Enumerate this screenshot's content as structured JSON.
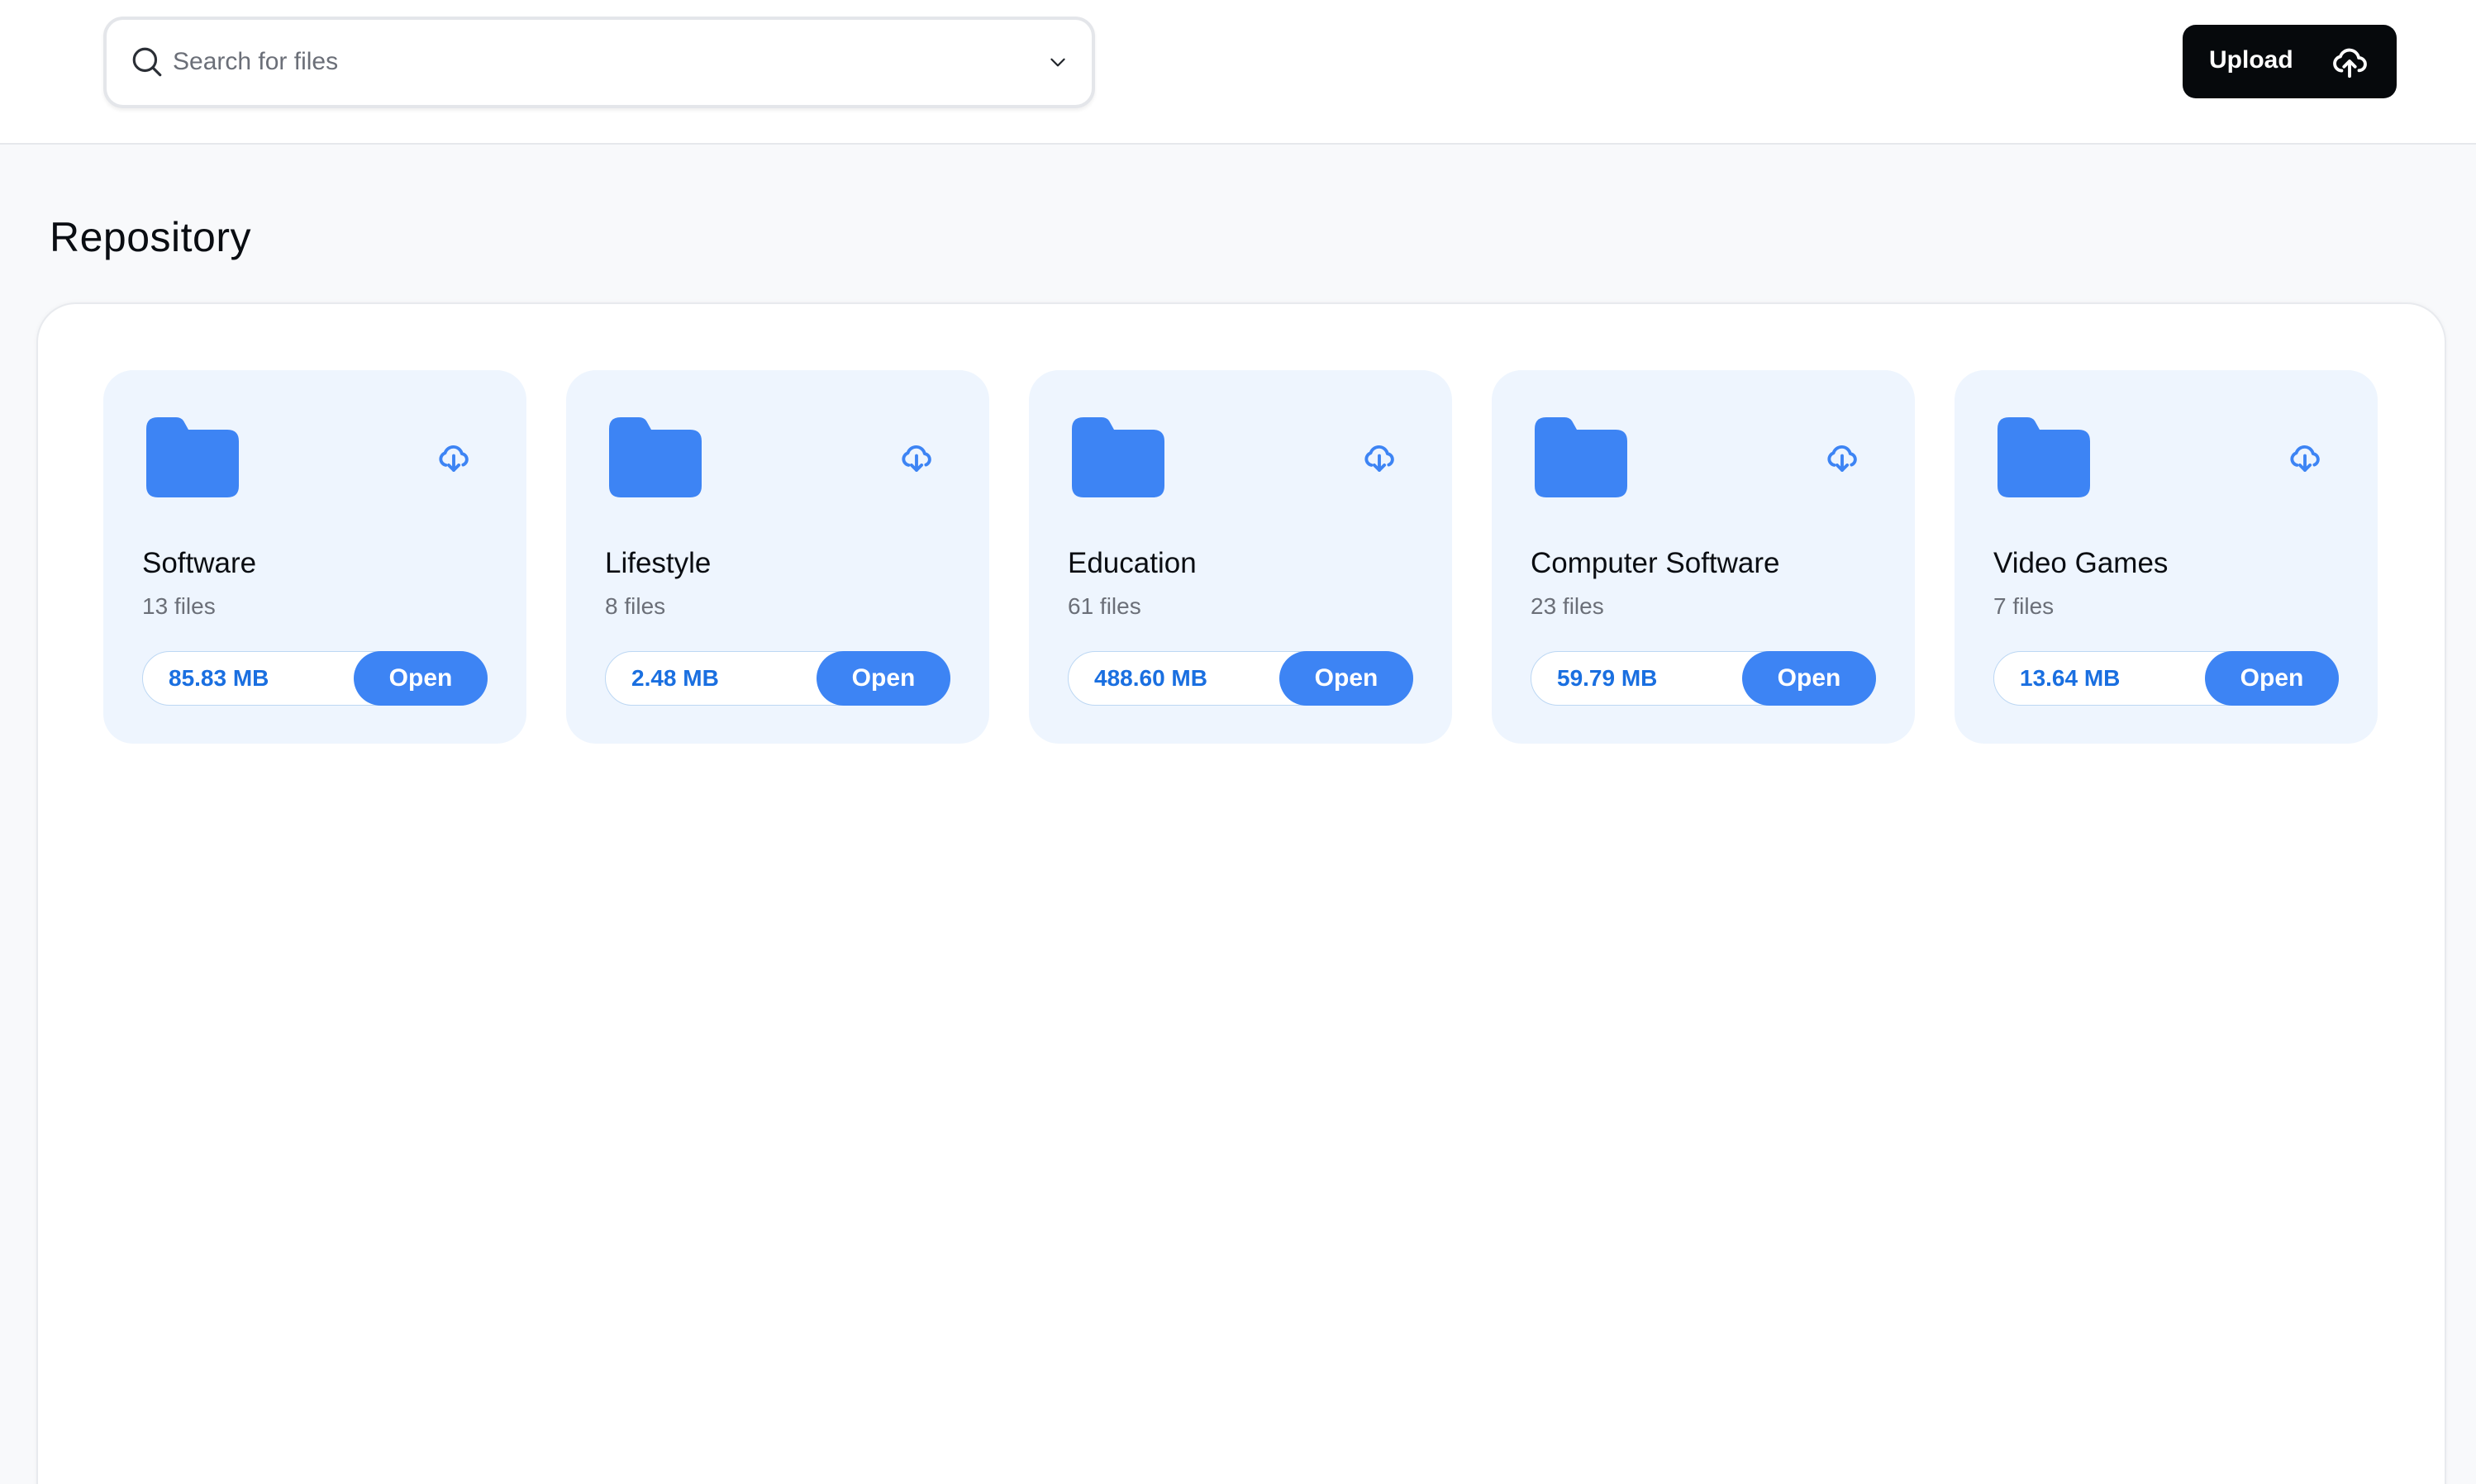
{
  "header": {
    "search": {
      "placeholder": "Search for files",
      "value": "",
      "icon": "search-icon",
      "dropdown_icon": "chevron-down-icon"
    },
    "upload_button": {
      "label": "Upload",
      "icon": "cloud-upload-icon"
    }
  },
  "main": {
    "title": "Repository",
    "folders": [
      {
        "name": "Software",
        "file_count": "13 files",
        "size": "85.83 MB",
        "open_label": "Open",
        "icon": "folder-icon",
        "action_icon": "cloud-download-icon"
      },
      {
        "name": "Lifestyle",
        "file_count": "8 files",
        "size": "2.48 MB",
        "open_label": "Open",
        "icon": "folder-icon",
        "action_icon": "cloud-download-icon"
      },
      {
        "name": "Education",
        "file_count": "61 files",
        "size": "488.60 MB",
        "open_label": "Open",
        "icon": "folder-icon",
        "action_icon": "cloud-download-icon"
      },
      {
        "name": "Computer Software",
        "file_count": "23 files",
        "size": "59.79 MB",
        "open_label": "Open",
        "icon": "folder-icon",
        "action_icon": "cloud-download-icon"
      },
      {
        "name": "Video Games",
        "file_count": "7 files",
        "size": "13.64 MB",
        "open_label": "Open",
        "icon": "folder-icon",
        "action_icon": "cloud-download-icon"
      }
    ]
  },
  "colors": {
    "accent": "#3d84f4",
    "size_text": "#1a6fe0",
    "card_bg": "#eef5fe",
    "upload_bg": "#06090c",
    "page_bg": "#f8f9fb"
  }
}
